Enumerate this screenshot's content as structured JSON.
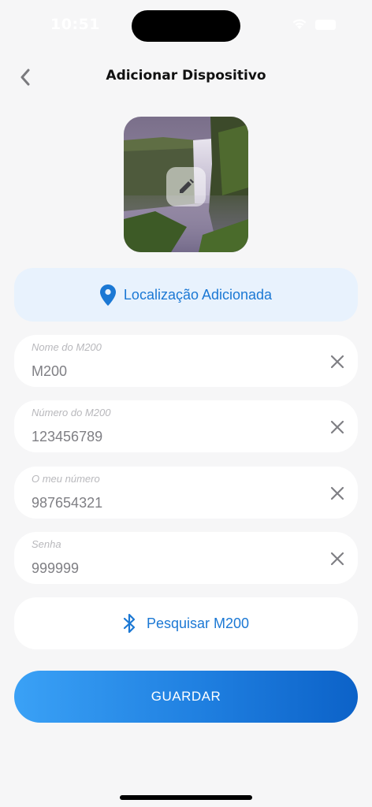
{
  "status_bar": {
    "time": "10:51"
  },
  "header": {
    "title": "Adicionar Dispositivo"
  },
  "location": {
    "label": "Localização Adicionada"
  },
  "fields": [
    {
      "label": "Nome do M200",
      "value": "M200"
    },
    {
      "label": "Número do M200",
      "value": "123456789"
    },
    {
      "label": "O meu número",
      "value": "987654321"
    },
    {
      "label": "Senha",
      "value": "999999"
    }
  ],
  "search": {
    "label": "Pesquisar M200"
  },
  "save": {
    "label": "GUARDAR"
  },
  "colors": {
    "accent": "#1b78d4",
    "location_bg": "#e8f2fd",
    "background": "#f6f6f7",
    "save_gradient_start": "#3aa1f6",
    "save_gradient_end": "#0c62c8"
  },
  "icons": {
    "back": "chevron-left-icon",
    "edit": "pencil-icon",
    "location": "map-pin-icon",
    "clear": "close-icon",
    "search": "bluetooth-icon"
  }
}
